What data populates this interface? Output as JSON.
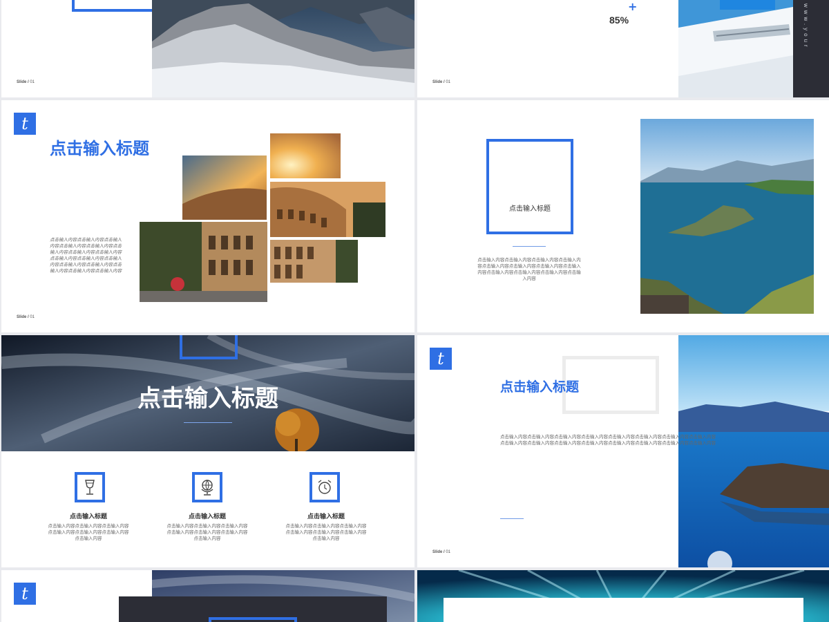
{
  "slide_label": "Slide /",
  "slide_number": "01",
  "logo_letter": "t",
  "title": "点击输入标题",
  "body_text_long": "点击输入内容点击输入内容点击输入内容点击输入内容点击输入内容点击输入内容点击输入内容点击输入内容点击输入内容点击输入内容点击输入内容点击输入内容点击输入内容点击输入内容点击输入内容点击输入内容",
  "body_text_medium": "点击输入内容点击输入内容点击输入内容点击输入内容点击输入内容点击输入内容点击输入内容点击输入内容点击输入内容点击输入内容点击输入内容点击输入内容",
  "body_text_short": "点击输入内容点击输入内容点击输入内容点击输入内容点击输入内容点击输入内容点击输入内容",
  "slide2": {
    "percent": "85%",
    "plus": "+",
    "vertical_text": "www.your"
  },
  "features": [
    {
      "icon": "wine-glass-icon",
      "title": "点击输入标题",
      "text": "点击输入内容点击输入内容点击输入内容点击输入内容点击输入内容点击输入内容点击输入内容"
    },
    {
      "icon": "globe-icon",
      "title": "点击输入标题",
      "text": "点击输入内容点击输入内容点击输入内容点击输入内容点击输入内容点击输入内容点击输入内容"
    },
    {
      "icon": "alarm-clock-icon",
      "title": "点击输入标题",
      "text": "点击输入内容点击输入内容点击输入内容点击输入内容点击输入内容点击输入内容点击输入内容"
    }
  ],
  "colors": {
    "accent": "#2f6fe4",
    "dark": "#2c2d36"
  }
}
